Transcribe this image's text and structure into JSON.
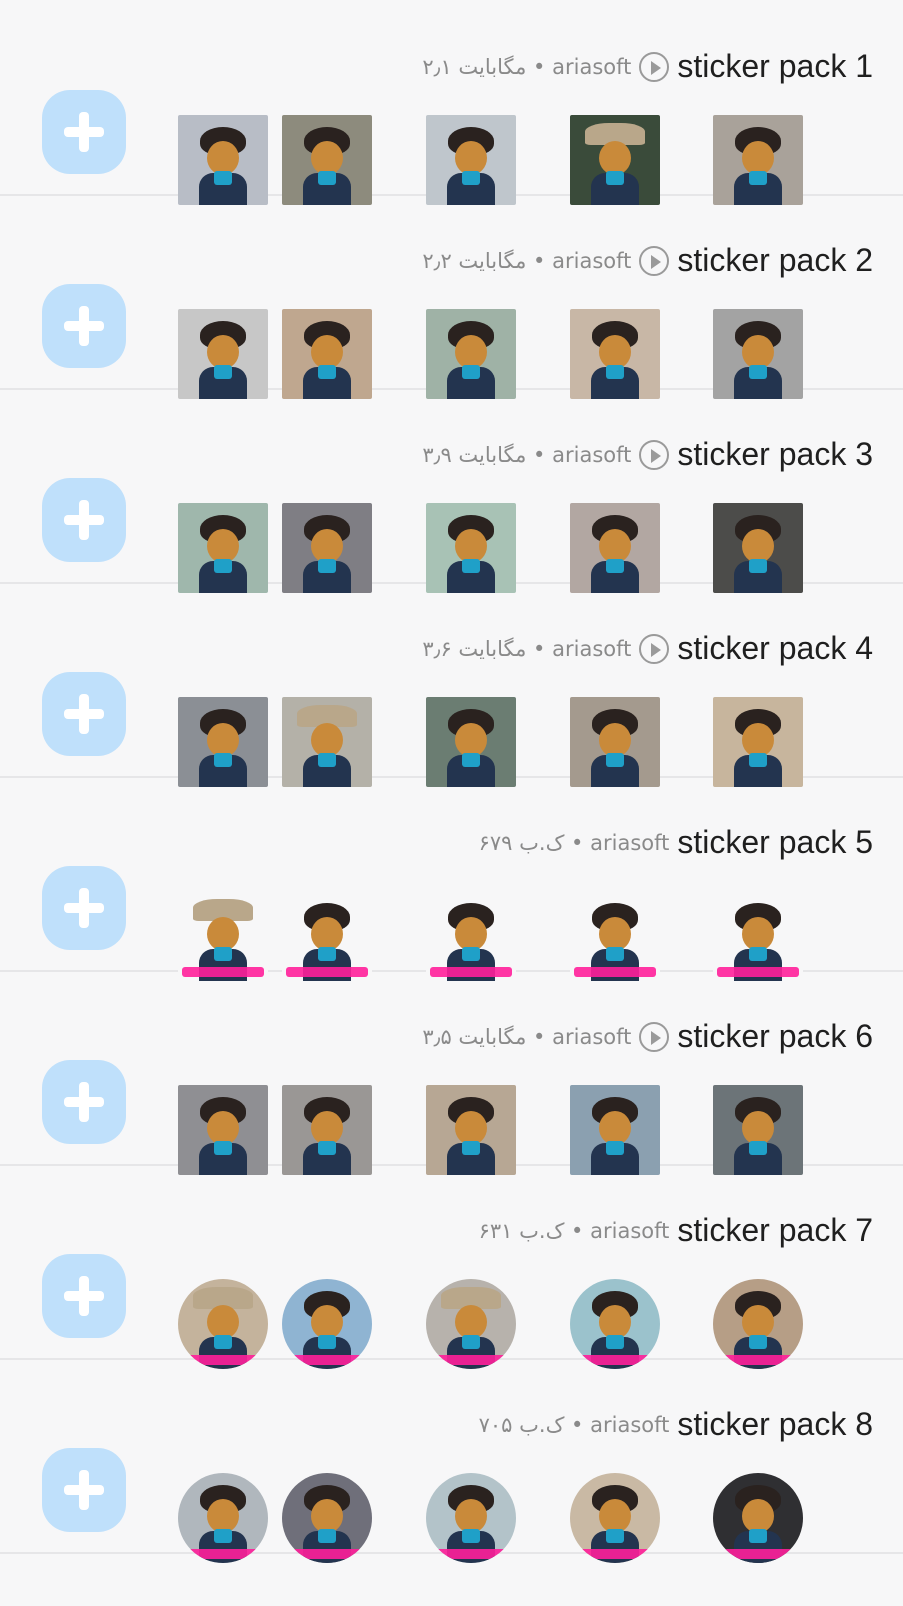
{
  "packs": [
    {
      "title": "sticker pack 1",
      "publisher": "ariasoft",
      "size": "۲٫۱ مگابایت",
      "animated": true,
      "style": "square",
      "caption": false,
      "bgs": [
        "#b8bdc6",
        "#8d8b7d",
        "#bfc6cc",
        "#3a4b3a",
        "#a9a29a"
      ]
    },
    {
      "title": "sticker pack 2",
      "publisher": "ariasoft",
      "size": "۲٫۲ مگابایت",
      "animated": true,
      "style": "square",
      "caption": false,
      "bgs": [
        "#c7c7c7",
        "#bfa78f",
        "#9fb2a6",
        "#c8b7a6",
        "#a3a3a3"
      ]
    },
    {
      "title": "sticker pack 3",
      "publisher": "ariasoft",
      "size": "۳٫۹ مگابایت",
      "animated": true,
      "style": "square",
      "caption": false,
      "bgs": [
        "#9fb7ac",
        "#7f7e84",
        "#a8c2b5",
        "#b2a7a2",
        "#4c4c4a"
      ]
    },
    {
      "title": "sticker pack 4",
      "publisher": "ariasoft",
      "size": "۳٫۶ مگابایت",
      "animated": true,
      "style": "square",
      "caption": false,
      "bgs": [
        "#8b8f95",
        "#b4b1a8",
        "#6b7d72",
        "#a49a8e",
        "#c7b59d"
      ]
    },
    {
      "title": "sticker pack 5",
      "publisher": "ariasoft",
      "size": "۶۷۹ ک.ب",
      "animated": false,
      "style": "cutout",
      "caption": true,
      "bgs": [
        "#f7f7f8",
        "#f7f7f8",
        "#f7f7f8",
        "#f7f7f8",
        "#f7f7f8"
      ]
    },
    {
      "title": "sticker pack 6",
      "publisher": "ariasoft",
      "size": "۳٫۵ مگابایت",
      "animated": true,
      "style": "square",
      "caption": false,
      "bgs": [
        "#8f8f93",
        "#9a9795",
        "#b7a794",
        "#8ba0b0",
        "#6c7478"
      ]
    },
    {
      "title": "sticker pack 7",
      "publisher": "ariasoft",
      "size": "۶۳۱ ک.ب",
      "animated": false,
      "style": "round",
      "caption": true,
      "bgs": [
        "#c4b39c",
        "#8fb4d2",
        "#b7b2ac",
        "#9bc2cc",
        "#b69e86"
      ]
    },
    {
      "title": "sticker pack 8",
      "publisher": "ariasoft",
      "size": "۷۰۵ ک.ب",
      "animated": false,
      "style": "round",
      "caption": true,
      "bgs": [
        "#b0b7bd",
        "#6f6f7a",
        "#b3c3c9",
        "#c9b9a4",
        "#2f2f32"
      ]
    }
  ],
  "ui": {
    "separator": " • "
  }
}
